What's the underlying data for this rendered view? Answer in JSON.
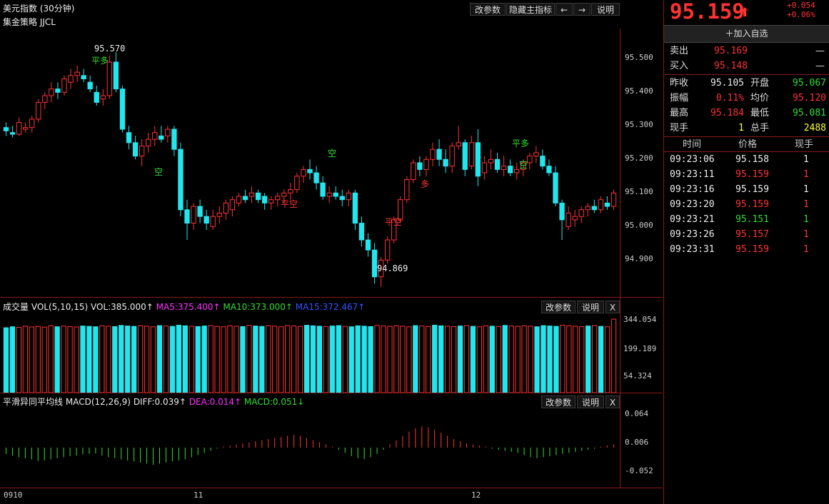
{
  "main_chart": {
    "title": "美元指数 (30分钟)",
    "strategy": "集金策略 JJCL",
    "buttons": [
      "改参数",
      "隐藏主指标",
      "←",
      "→",
      "说明"
    ],
    "y_ticks": [
      "95.500",
      "95.400",
      "95.300",
      "95.200",
      "95.100",
      "95.000",
      "94.900"
    ],
    "high_label": "95.570",
    "low_label": "94.869",
    "signals": [
      {
        "text": "平多",
        "color": "#33dd33"
      },
      {
        "text": "空",
        "color": "#33dd33"
      },
      {
        "text": "平空",
        "color": "#ff3333"
      },
      {
        "text": "空",
        "color": "#33dd33"
      },
      {
        "text": "平空",
        "color": "#ff3333"
      },
      {
        "text": "多",
        "color": "#ff3333"
      },
      {
        "text": "平多",
        "color": "#33dd33"
      },
      {
        "text": "空",
        "color": "#33dd33"
      }
    ]
  },
  "volume_panel": {
    "title": "成交量",
    "params": "VOL(5,10,15)",
    "vol": "VOL:385.000↑",
    "ma5": "MA5:375.400↑",
    "ma10": "MA10:373.000↑",
    "ma15": "MA15:372.467↑",
    "buttons": [
      "改参数",
      "说明",
      "X"
    ],
    "y_ticks": [
      "344.054",
      "199.189",
      "54.324"
    ]
  },
  "macd_panel": {
    "title": "平滑异同平均线",
    "params": "MACD(12,26,9)",
    "diff": "DIFF:0.039↑",
    "dea": "DEA:0.014↑",
    "macd": "MACD:0.051↓",
    "buttons": [
      "改参数",
      "说明",
      "X"
    ],
    "y_ticks": [
      "0.064",
      "0.006",
      "-0.052"
    ]
  },
  "x_axis": {
    "labels": [
      "0910",
      "11",
      "12"
    ]
  },
  "quote": {
    "price": "95.159",
    "arrow": "⬆",
    "change": "+0.054",
    "change_pct": "+0.06%",
    "add_watch": "加入自选",
    "sell_label": "卖出",
    "sell_price": "95.169",
    "sell_vol": "—",
    "buy_label": "买入",
    "buy_price": "95.148",
    "buy_vol": "—",
    "stats": [
      {
        "l1": "昨收",
        "v1": "95.105",
        "c1": "white",
        "l2": "开盘",
        "v2": "95.067",
        "c2": "green"
      },
      {
        "l1": "振幅",
        "v1": "0.11%",
        "c1": "red",
        "l2": "均价",
        "v2": "95.120",
        "c2": "red"
      },
      {
        "l1": "最高",
        "v1": "95.184",
        "c1": "red",
        "l2": "最低",
        "v2": "95.081",
        "c2": "green"
      },
      {
        "l1": "现手",
        "v1": "1",
        "c1": "yellow",
        "l2": "总手",
        "v2": "2488",
        "c2": "yellow"
      }
    ],
    "ticks_headers": [
      "时间",
      "价格",
      "现手"
    ],
    "ticks": [
      {
        "time": "09:23:06",
        "price": "95.158",
        "vol": "1",
        "c": "white"
      },
      {
        "time": "09:23:11",
        "price": "95.159",
        "vol": "1",
        "c": "red"
      },
      {
        "time": "09:23:16",
        "price": "95.159",
        "vol": "1",
        "c": "white"
      },
      {
        "time": "09:23:20",
        "price": "95.159",
        "vol": "1",
        "c": "red"
      },
      {
        "time": "09:23:21",
        "price": "95.151",
        "vol": "1",
        "c": "green"
      },
      {
        "time": "09:23:26",
        "price": "95.157",
        "vol": "1",
        "c": "red"
      },
      {
        "time": "09:23:31",
        "price": "95.159",
        "vol": "1",
        "c": "red"
      }
    ]
  },
  "chart_data": {
    "type": "candlestick",
    "y_range": [
      94.84,
      95.64
    ],
    "candles": [
      [
        95.345,
        95.36,
        95.32,
        95.335
      ],
      [
        95.33,
        95.35,
        95.315,
        95.325
      ],
      [
        95.325,
        95.375,
        95.32,
        95.36
      ],
      [
        95.34,
        95.36,
        95.33,
        95.345
      ],
      [
        95.345,
        95.38,
        95.33,
        95.37
      ],
      [
        95.37,
        95.43,
        95.36,
        95.42
      ],
      [
        95.42,
        95.45,
        95.4,
        95.44
      ],
      [
        95.44,
        95.48,
        95.42,
        95.46
      ],
      [
        95.46,
        95.48,
        95.43,
        95.45
      ],
      [
        95.45,
        95.5,
        95.44,
        95.49
      ],
      [
        95.48,
        95.52,
        95.46,
        95.5
      ],
      [
        95.5,
        95.53,
        95.48,
        95.51
      ],
      [
        95.5,
        95.52,
        95.48,
        95.49
      ],
      [
        95.48,
        95.5,
        95.45,
        95.46
      ],
      [
        95.45,
        95.47,
        95.41,
        95.42
      ],
      [
        95.43,
        95.46,
        95.41,
        95.44
      ],
      [
        95.44,
        95.56,
        95.43,
        95.54
      ],
      [
        95.54,
        95.57,
        95.45,
        95.46
      ],
      [
        95.46,
        95.47,
        95.33,
        95.34
      ],
      [
        95.33,
        95.35,
        95.28,
        95.3
      ],
      [
        95.3,
        95.32,
        95.25,
        95.26
      ],
      [
        95.26,
        95.31,
        95.23,
        95.29
      ],
      [
        95.29,
        95.33,
        95.27,
        95.31
      ],
      [
        95.31,
        95.35,
        95.29,
        95.33
      ],
      [
        95.32,
        95.35,
        95.3,
        95.31
      ],
      [
        95.32,
        95.35,
        95.3,
        95.34
      ],
      [
        95.34,
        95.35,
        95.26,
        95.28
      ],
      [
        95.28,
        95.3,
        95.08,
        95.1
      ],
      [
        95.1,
        95.13,
        95.01,
        95.06
      ],
      [
        95.06,
        95.12,
        95.04,
        95.11
      ],
      [
        95.11,
        95.13,
        95.06,
        95.08
      ],
      [
        95.08,
        95.1,
        95.04,
        95.06
      ],
      [
        95.05,
        95.1,
        95.04,
        95.08
      ],
      [
        95.08,
        95.11,
        95.06,
        95.09
      ],
      [
        95.09,
        95.13,
        95.07,
        95.12
      ],
      [
        95.1,
        95.14,
        95.08,
        95.13
      ],
      [
        95.12,
        95.15,
        95.11,
        95.14
      ],
      [
        95.14,
        95.16,
        95.12,
        95.13
      ],
      [
        95.14,
        95.17,
        95.12,
        95.15
      ],
      [
        95.15,
        95.16,
        95.12,
        95.13
      ],
      [
        95.14,
        95.15,
        95.1,
        95.12
      ],
      [
        95.12,
        95.14,
        95.1,
        95.13
      ],
      [
        95.13,
        95.15,
        95.11,
        95.14
      ],
      [
        95.14,
        95.16,
        95.12,
        95.15
      ],
      [
        95.15,
        95.18,
        95.13,
        95.16
      ],
      [
        95.16,
        95.21,
        95.15,
        95.2
      ],
      [
        95.2,
        95.23,
        95.18,
        95.22
      ],
      [
        95.22,
        95.25,
        95.19,
        95.21
      ],
      [
        95.21,
        95.23,
        95.16,
        95.18
      ],
      [
        95.18,
        95.2,
        95.13,
        95.14
      ],
      [
        95.14,
        95.17,
        95.12,
        95.15
      ],
      [
        95.15,
        95.17,
        95.13,
        95.14
      ],
      [
        95.14,
        95.16,
        95.11,
        95.13
      ],
      [
        95.13,
        95.16,
        95.11,
        95.15
      ],
      [
        95.15,
        95.16,
        95.04,
        95.06
      ],
      [
        95.06,
        95.08,
        94.99,
        95.01
      ],
      [
        95.01,
        95.03,
        94.96,
        94.98
      ],
      [
        94.98,
        95.0,
        94.88,
        94.9
      ],
      [
        94.9,
        94.96,
        94.87,
        94.95
      ],
      [
        94.95,
        95.02,
        94.94,
        95.01
      ],
      [
        95.01,
        95.08,
        95.0,
        95.07
      ],
      [
        95.07,
        95.14,
        95.06,
        95.13
      ],
      [
        95.13,
        95.2,
        95.12,
        95.19
      ],
      [
        95.19,
        95.25,
        95.18,
        95.24
      ],
      [
        95.24,
        95.26,
        95.2,
        95.22
      ],
      [
        95.22,
        95.26,
        95.2,
        95.25
      ],
      [
        95.25,
        95.3,
        95.23,
        95.28
      ],
      [
        95.28,
        95.31,
        95.23,
        95.25
      ],
      [
        95.25,
        95.28,
        95.21,
        95.23
      ],
      [
        95.23,
        95.3,
        95.21,
        95.29
      ],
      [
        95.29,
        95.35,
        95.28,
        95.3
      ],
      [
        95.3,
        95.31,
        95.2,
        95.22
      ],
      [
        95.23,
        95.32,
        95.22,
        95.3
      ],
      [
        95.3,
        95.34,
        95.17,
        95.2
      ],
      [
        95.21,
        95.26,
        95.19,
        95.24
      ],
      [
        95.24,
        95.28,
        95.22,
        95.25
      ],
      [
        95.25,
        95.27,
        95.21,
        95.22
      ],
      [
        95.22,
        95.26,
        95.2,
        95.23
      ],
      [
        95.23,
        95.25,
        95.2,
        95.21
      ],
      [
        95.21,
        95.24,
        95.19,
        95.22
      ],
      [
        95.22,
        95.25,
        95.2,
        95.24
      ],
      [
        95.24,
        95.27,
        95.22,
        95.26
      ],
      [
        95.26,
        95.29,
        95.24,
        95.27
      ],
      [
        95.26,
        95.28,
        95.22,
        95.23
      ],
      [
        95.23,
        95.25,
        95.2,
        95.21
      ],
      [
        95.21,
        95.23,
        95.11,
        95.12
      ],
      [
        95.12,
        95.13,
        95.01,
        95.07
      ],
      [
        95.05,
        95.11,
        95.04,
        95.09
      ],
      [
        95.07,
        95.1,
        95.05,
        95.08
      ],
      [
        95.08,
        95.11,
        95.06,
        95.1
      ],
      [
        95.1,
        95.12,
        95.08,
        95.11
      ],
      [
        95.11,
        95.13,
        95.09,
        95.1
      ],
      [
        95.1,
        95.14,
        95.09,
        95.13
      ],
      [
        95.12,
        95.14,
        95.1,
        95.11
      ],
      [
        95.11,
        95.16,
        95.1,
        95.15
      ]
    ],
    "volume": [
      340,
      345,
      342,
      348,
      344,
      347,
      343,
      350,
      345,
      348,
      346,
      344,
      349,
      347,
      345,
      350,
      348,
      346,
      352,
      349,
      347,
      350,
      348,
      345,
      351,
      349,
      347,
      353,
      350,
      348,
      346,
      349,
      351,
      347,
      345,
      350,
      348,
      346,
      352,
      349,
      347,
      350,
      348,
      345,
      351,
      349,
      347,
      353,
      350,
      348,
      346,
      349,
      351,
      347,
      345,
      350,
      348,
      346,
      352,
      349,
      347,
      350,
      348,
      345,
      351,
      349,
      347,
      353,
      350,
      348,
      346,
      349,
      351,
      347,
      345,
      350,
      348,
      346,
      352,
      349,
      347,
      350,
      348,
      345,
      351,
      349,
      347,
      353,
      350,
      348,
      346,
      349,
      351,
      347,
      345,
      385
    ],
    "macd_hist": [
      -0.012,
      -0.015,
      -0.018,
      -0.02,
      -0.022,
      -0.025,
      -0.024,
      -0.022,
      -0.02,
      -0.018,
      -0.016,
      -0.015,
      -0.013,
      -0.012,
      -0.011,
      -0.015,
      -0.018,
      -0.02,
      -0.022,
      -0.024,
      -0.026,
      -0.028,
      -0.03,
      -0.032,
      -0.03,
      -0.028,
      -0.026,
      -0.024,
      -0.022,
      -0.018,
      -0.014,
      -0.01,
      -0.006,
      -0.002,
      0.002,
      0.004,
      0.006,
      0.008,
      0.01,
      0.012,
      0.014,
      0.016,
      0.018,
      0.02,
      0.022,
      0.024,
      0.022,
      0.018,
      0.014,
      0.01,
      0.006,
      0.002,
      -0.004,
      -0.01,
      -0.016,
      -0.02,
      -0.022,
      -0.018,
      -0.012,
      -0.004,
      0.006,
      0.014,
      0.022,
      0.03,
      0.036,
      0.04,
      0.038,
      0.034,
      0.028,
      0.022,
      0.016,
      0.012,
      0.008,
      0.006,
      0.004,
      0.002,
      -0.002,
      -0.004,
      -0.006,
      -0.008,
      -0.01,
      -0.014,
      -0.018,
      -0.02,
      -0.018,
      -0.016,
      -0.014,
      -0.012,
      -0.01,
      -0.008,
      -0.006,
      -0.004,
      -0.002,
      0.002,
      0.004,
      0.006
    ],
    "macd_y_range": [
      -0.075,
      0.075
    ]
  }
}
